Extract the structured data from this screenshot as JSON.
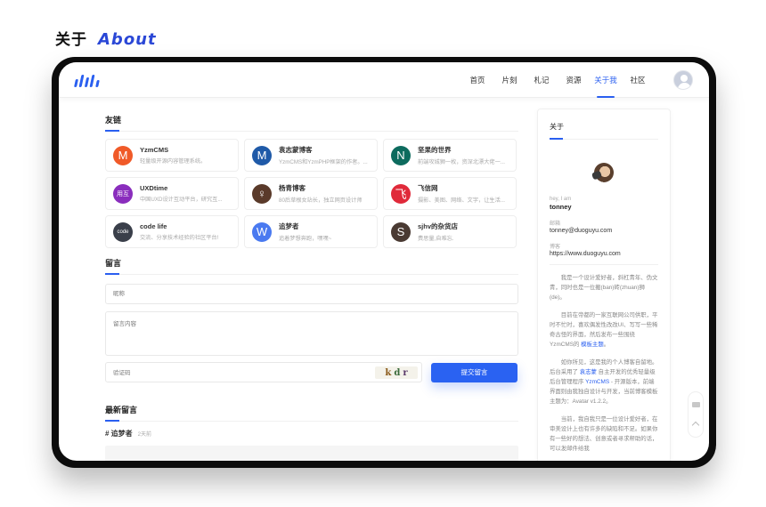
{
  "page_heading": {
    "zh": "关于",
    "en": "About"
  },
  "header": {
    "logo_name": "logo",
    "nav": [
      {
        "label": "首页",
        "active": false
      },
      {
        "label": "片刻",
        "active": false
      },
      {
        "label": "札记",
        "active": false
      },
      {
        "label": "资源",
        "active": false
      },
      {
        "label": "关于我",
        "active": true
      },
      {
        "label": "社区",
        "active": false
      }
    ],
    "accent_color": "#2a5ff0"
  },
  "friend_links": {
    "title": "友链",
    "items": [
      {
        "name": "YzmCMS",
        "desc": "轻量级开源内容管理系统。",
        "logo_text": "M",
        "logo_color": "#f05a28"
      },
      {
        "name": "袁志蒙博客",
        "desc": "YzmCMS和YzmPHP框架的作者。...",
        "logo_text": "M",
        "logo_color": "#1f5aa8"
      },
      {
        "name": "坚果的世界",
        "desc": "前端攻城狮一枚，资深北漂大佬一...",
        "logo_text": "N",
        "logo_color": "#0d6b5e"
      },
      {
        "name": "UXDtime",
        "desc": "中国UXD设计互动平台，研究互...",
        "logo_text": "用互",
        "logo_color": "#8a2dbd"
      },
      {
        "name": "杨青博客",
        "desc": "80后草根女站长，独立网页设计师",
        "logo_text": "♀",
        "logo_color": "#5a3a2a"
      },
      {
        "name": "飞信网",
        "desc": "摄影、美图、网络、文字，让生活...",
        "logo_text": "飞",
        "logo_color": "#e02a3a"
      },
      {
        "name": "code life",
        "desc": "交流、分享技术经验的社区平台!",
        "logo_text": "code",
        "logo_color": "#3a3f4a"
      },
      {
        "name": "追梦者",
        "desc": "追着梦想奔跑，嘿嘿~",
        "logo_text": "W",
        "logo_color": "#4a7af0"
      },
      {
        "name": "sjhv的杂货店",
        "desc": "费思量,自难忘.",
        "logo_text": "S",
        "logo_color": "#4a3a33"
      }
    ]
  },
  "message_form": {
    "title": "留言",
    "nickname_placeholder": "昵称",
    "content_placeholder": "留言内容",
    "captcha_placeholder": "验证码",
    "captcha_chars": [
      "k",
      "d",
      "r"
    ],
    "submit_label": "提交留言"
  },
  "latest": {
    "title": "最新留言",
    "comments": [
      {
        "author": "# 追梦者",
        "time": "2天前"
      }
    ]
  },
  "sidebar": {
    "title": "关于",
    "hey": "hey, I am",
    "name": "tonney",
    "email_label": "邮箱",
    "email": "tonney@duoguyu.com",
    "blog_label": "博客",
    "blog": "https://www.duoguyu.com",
    "bio": [
      {
        "text": "我是一个设计爱好者，斜杠青年、伪文青，同时也是一位搬(ban)砖(zhuan)狮(de)。"
      },
      {
        "pre": "目前在帝都的一家互联网公司供职，平时不忙时，喜欢偶发性改改UI、写写一些稀奇古怪的界面，然后发布一些围绕YzmCMS的 ",
        "link": "模板主题",
        "post": "。"
      },
      {
        "pre": "如你所见，这是我的个人博客自留地。后台采用了 ",
        "link": "袁志蒙",
        "mid": " 自主开发的优秀轻量级后台管理程序 ",
        "link2": "YzmCMS",
        "post": " - 开源版本，前端界面则由我独自设计与开发，当前博客模板主题为：Avatar v1.2.2。"
      },
      {
        "text": "当前，我自我只是一位设计爱好者，在审美设计上也有许多的缺陷和不足。如果你有一些好的想法、创意或者寻求帮助的话，可以发邮件给我"
      }
    ]
  },
  "float_tools": {
    "mail": "mail-icon",
    "top": "back-to-top-icon"
  }
}
